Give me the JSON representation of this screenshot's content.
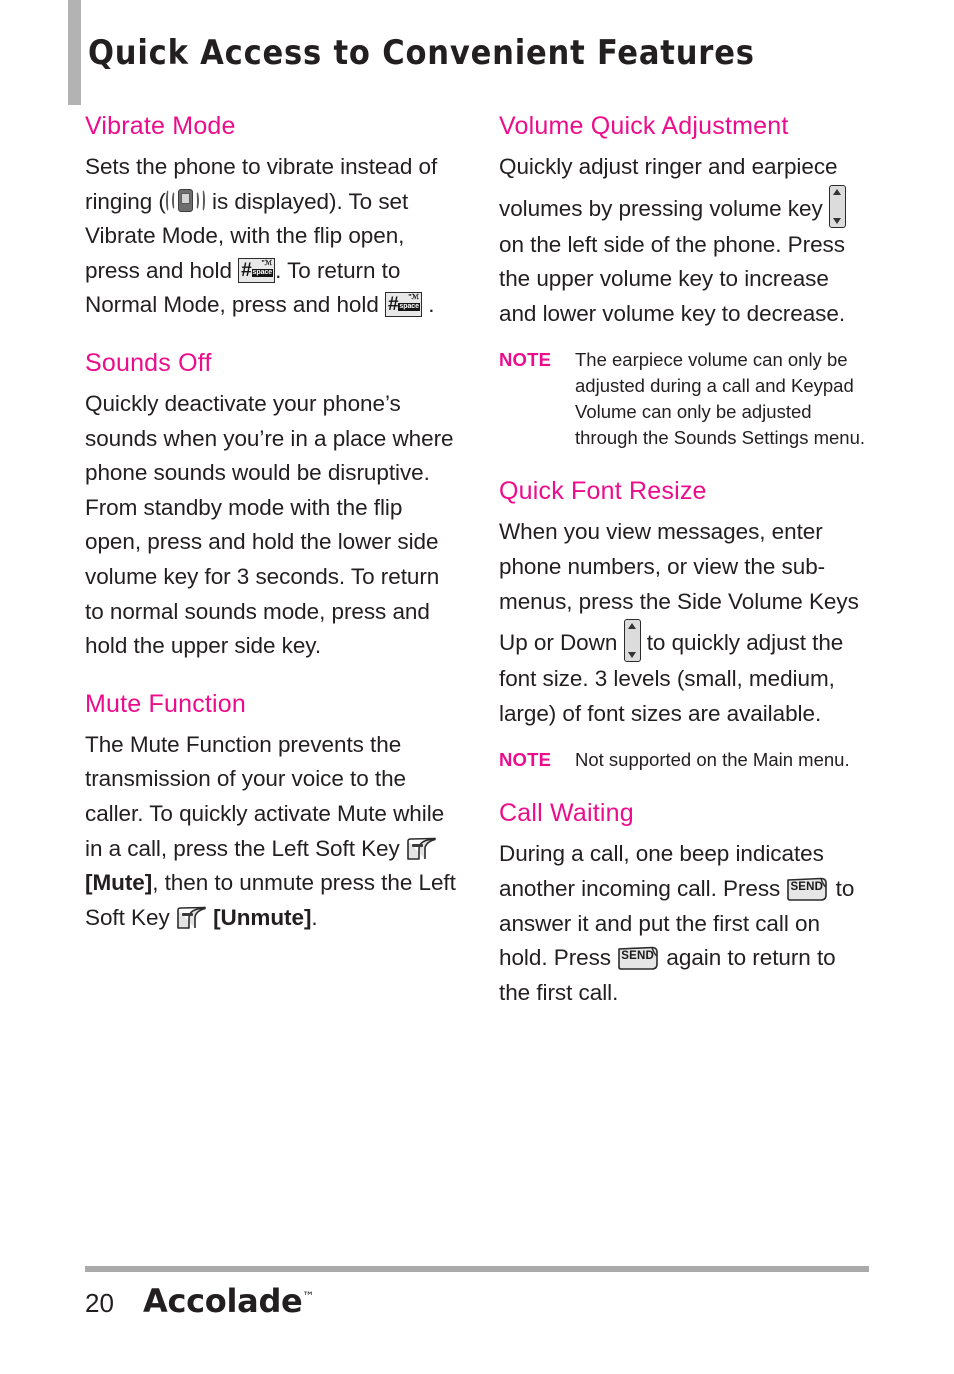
{
  "header": {
    "title": "Quick Access to Convenient Features"
  },
  "left_column": {
    "sections": [
      {
        "heading": "Vibrate Mode",
        "text_1": "Sets the phone to vibrate instead of ringing (",
        "text_2": " is displayed). To set Vibrate Mode, with the flip open, press and hold ",
        "text_3": ". To return to Normal Mode, press and hold ",
        "text_4": " ."
      },
      {
        "heading": "Sounds Off",
        "para_1": "Quickly deactivate your phone’s sounds when you’re in a place where phone sounds would be disruptive.",
        "para_2": "From standby mode with the flip open, press and hold the lower side volume key for 3 seconds.  To return to normal sounds mode, press and hold the upper side key."
      },
      {
        "heading": "Mute Function",
        "text_1": "The Mute Function prevents the transmission of your voice to the caller. To quickly activate Mute while in a call, press the Left Soft Key ",
        "text_2": " ",
        "bold_mute": "[Mute]",
        "text_3": ", then to unmute press the Left Soft Key ",
        "text_4": " ",
        "bold_unmute": "[Unmute]",
        "text_5": "."
      }
    ]
  },
  "right_column": {
    "sections": [
      {
        "heading": "Volume Quick Adjustment",
        "text_1": "Quickly adjust ringer and earpiece volumes by pressing volume key ",
        "text_2": " on the left side of the phone. Press the upper volume key to increase and lower volume key to decrease.",
        "note_label": "NOTE",
        "note_body": "The earpiece volume can only be adjusted during a call and Keypad Volume can only be adjusted through the Sounds Settings menu."
      },
      {
        "heading": "Quick Font Resize",
        "text_1": "When you view messages, enter phone numbers, or view the sub-menus, press the Side Volume Keys Up or Down ",
        "text_2": " to quickly adjust the font size. 3 levels (small, medium, large) of font sizes are available.",
        "note_label": "NOTE",
        "note_body": "Not supported on the Main menu."
      },
      {
        "heading": "Call Waiting",
        "text_1": "During a call, one beep indicates another incoming call. Press ",
        "text_2": " to answer it and put the first call on hold. Press ",
        "text_3": " again to return to the first call."
      }
    ]
  },
  "icons": {
    "vibrate": "vibrate-phone-icon",
    "hash_space_key": "hash-space-key-icon",
    "hash_label": "#",
    "hash_space_top": "\"ℳ",
    "hash_space_bottom": "space",
    "left_soft_key": "left-soft-key-icon",
    "volume_key": "volume-rocker-key-icon",
    "send_key": "send-key-icon",
    "send_label": "SEND"
  },
  "footer": {
    "page_number": "20",
    "brand": "Accolade",
    "trademark": "™"
  },
  "colors": {
    "accent_magenta": "#ec0d8c",
    "body_text": "#231f20",
    "rule_gray": "#aaaaaa",
    "header_tab_gray": "#b3b3b3"
  }
}
